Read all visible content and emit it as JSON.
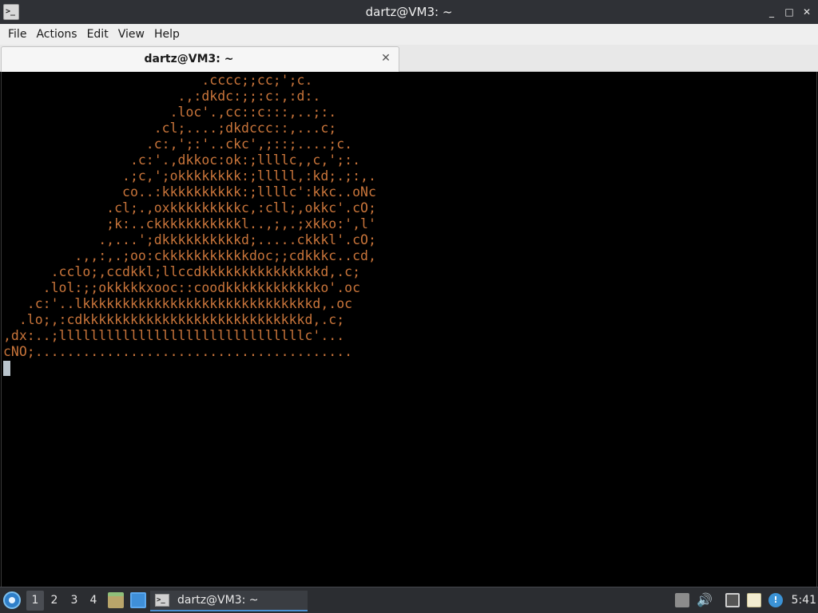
{
  "window": {
    "title": "dartz@VM3: ~",
    "buttons": {
      "minimize": "_",
      "maximize": "□",
      "close": "✕"
    }
  },
  "menubar": {
    "items": [
      "File",
      "Actions",
      "Edit",
      "View",
      "Help"
    ]
  },
  "tabs": [
    {
      "label": "dartz@VM3: ~",
      "close": "✕"
    }
  ],
  "terminal": {
    "text_color": "#c8743a",
    "background": "#000000",
    "lines": [
      "                         .cccc;;cc;';c.",
      "                      .,:dkdc:;;:c:,:d:.",
      "                     .loc'.,cc::c:::,..;:.",
      "                   .cl;....;dkdccc::,...c;",
      "                  .c:,';:'..ckc',;::;....;c.",
      "                .c:'.,dkkoc:ok:;llllc,,c,';:.",
      "               .;c,';okkkkkkkk:;lllll,:kd;.;:,.",
      "               co..:kkkkkkkkkk:;llllc':kkc..oNc",
      "             .cl;.,oxkkkkkkkkkc,:cll;,okkc'.cO;",
      "             ;k:..ckkkkkkkkkkkl..,;,.;xkko:',l'",
      "            .,...';dkkkkkkkkkkd;.....ckkkl'.cO;",
      "         .,,:,.;oo:ckkkkkkkkkkkdoc;;cdkkkc..cd,",
      "      .cclo;,ccdkkl;llccdkkkkkkkkkkkkkkkd,.c;",
      "     .lol:;;okkkkkxooc::coodkkkkkkkkkkkko'.oc",
      "   .c:'..lkkkkkkkkkkkkkkkkkkkkkkkkkkkkkd,.oc",
      "  .lo;,:cdkkkkkkkkkkkkkkkkkkkkkkkkkkkkd,.c;",
      ",dx:..;lllllllllllllllllllllllllllllllc'...",
      "cNO;........................................"
    ]
  },
  "taskbar": {
    "desktops": [
      "1",
      "2",
      "3",
      "4"
    ],
    "active_desktop": "1",
    "task_label": "dartz@VM3: ~",
    "clock": "5:41",
    "tray_notify_glyph": "!"
  }
}
